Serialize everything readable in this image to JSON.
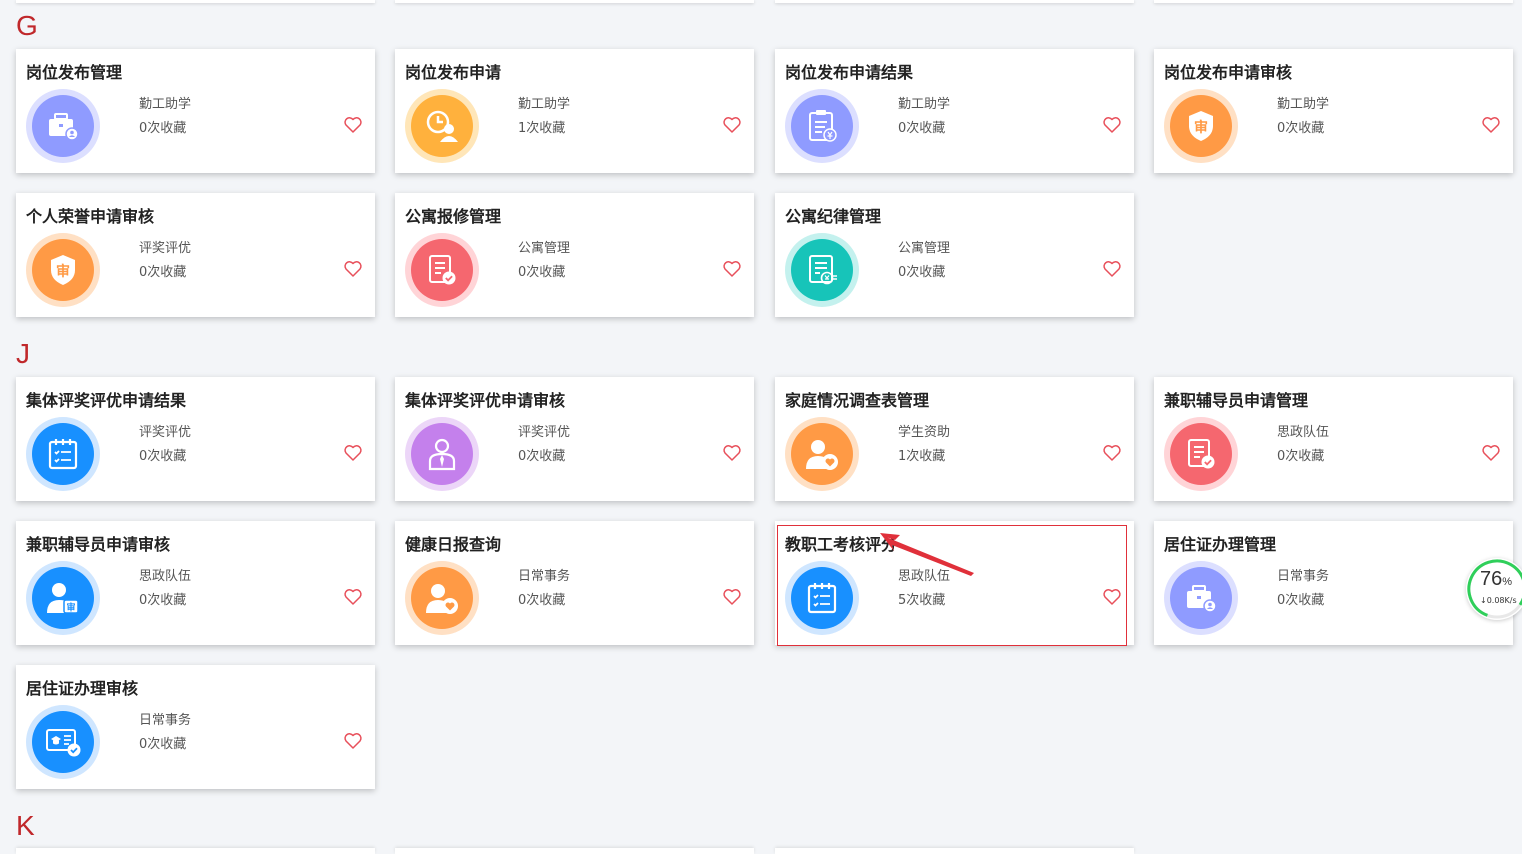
{
  "sections": {
    "g": "G",
    "j": "J",
    "k": "K"
  },
  "cards": [
    {
      "title": "岗位发布管理",
      "category": "勤工助学",
      "favorites": "0次收藏",
      "icon": "briefcase-user-icon",
      "color": "purple"
    },
    {
      "title": "岗位发布申请",
      "category": "勤工助学",
      "favorites": "1次收藏",
      "icon": "clock-user-icon",
      "color": "gold"
    },
    {
      "title": "岗位发布申请结果",
      "category": "勤工助学",
      "favorites": "0次收藏",
      "icon": "clipboard-yuan-icon",
      "color": "purple"
    },
    {
      "title": "岗位发布申请审核",
      "category": "勤工助学",
      "favorites": "0次收藏",
      "icon": "review-shield-icon",
      "color": "orange",
      "glyph": "审"
    },
    {
      "title": "个人荣誉申请审核",
      "category": "评奖评优",
      "favorites": "0次收藏",
      "icon": "review-shield-icon",
      "color": "orange",
      "glyph": "审"
    },
    {
      "title": "公寓报修管理",
      "category": "公寓管理",
      "favorites": "0次收藏",
      "icon": "document-check-icon",
      "color": "red"
    },
    {
      "title": "公寓纪律管理",
      "category": "公寓管理",
      "favorites": "0次收藏",
      "icon": "document-yuan-icon",
      "color": "teal"
    },
    {
      "title": "集体评奖评优申请结果",
      "category": "评奖评优",
      "favorites": "0次收藏",
      "icon": "calendar-list-icon",
      "color": "blue"
    },
    {
      "title": "集体评奖评优申请审核",
      "category": "评奖评优",
      "favorites": "0次收藏",
      "icon": "person-tie-icon",
      "color": "violet"
    },
    {
      "title": "家庭情况调查表管理",
      "category": "学生资助",
      "favorites": "1次收藏",
      "icon": "user-heart-icon",
      "color": "orange"
    },
    {
      "title": "兼职辅导员申请管理",
      "category": "思政队伍",
      "favorites": "0次收藏",
      "icon": "document-check-icon",
      "color": "red"
    },
    {
      "title": "兼职辅导员申请审核",
      "category": "思政队伍",
      "favorites": "0次收藏",
      "icon": "user-review-icon",
      "color": "blue",
      "glyph": "审"
    },
    {
      "title": "健康日报查询",
      "category": "日常事务",
      "favorites": "0次收藏",
      "icon": "user-heart-icon",
      "color": "orange"
    },
    {
      "title": "教职工考核评分",
      "category": "思政队伍",
      "favorites": "5次收藏",
      "icon": "calendar-list-icon",
      "color": "blue"
    },
    {
      "title": "居住证办理管理",
      "category": "日常事务",
      "favorites": "0次收藏",
      "icon": "briefcase-user-icon",
      "color": "purple"
    },
    {
      "title": "居住证办理审核",
      "category": "日常事务",
      "favorites": "0次收藏",
      "icon": "id-card-check-icon",
      "color": "blue"
    }
  ],
  "speed_widget": {
    "percent": "76",
    "percent_unit": "%",
    "rate": "↓0.08K/s"
  },
  "colors": {
    "section_letter": "#c0282b",
    "heart": "#e8505b",
    "highlight": "#e0303a"
  }
}
